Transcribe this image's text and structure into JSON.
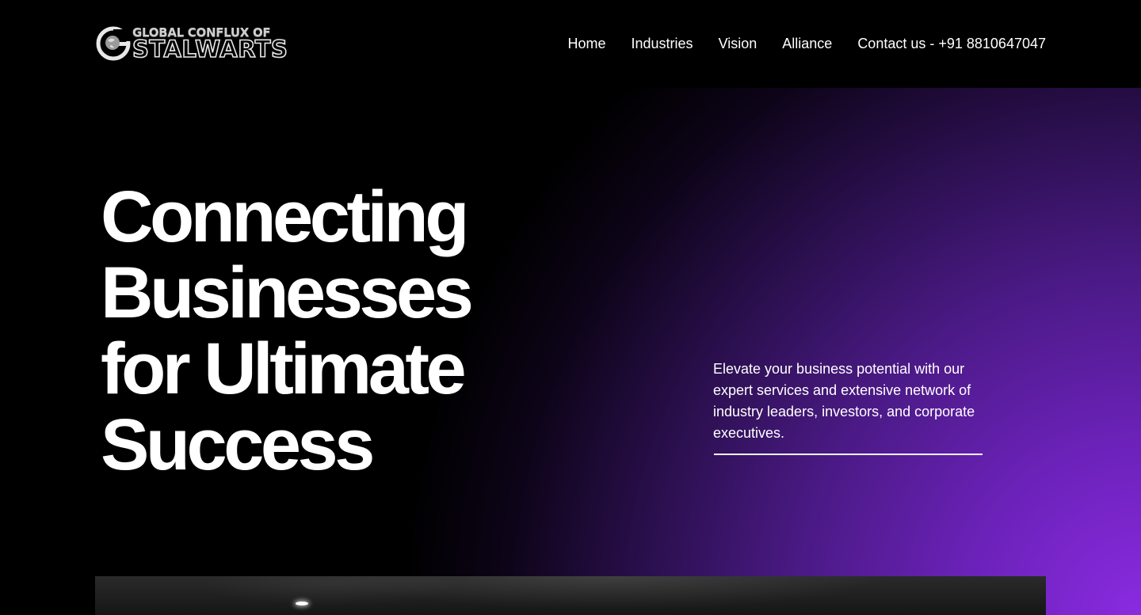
{
  "header": {
    "logo": {
      "line1": "GLOBAL CONFLUX OF",
      "line2": "STALWARTS",
      "icon": "globe-g-icon"
    },
    "nav": [
      {
        "label": "Home"
      },
      {
        "label": "Industries"
      },
      {
        "label": "Vision"
      },
      {
        "label": "Alliance"
      },
      {
        "label": "Contact us - +91 8810647047"
      }
    ]
  },
  "hero": {
    "title_lines": [
      "Connecting",
      "Businesses",
      "for Ultimate",
      "Success"
    ],
    "description": "Elevate your business potential with our expert services and extensive network of industry leaders, investors, and corporate executives."
  },
  "colors": {
    "background": "#000000",
    "accent_purple": "#8a2be0",
    "text": "#ffffff"
  }
}
